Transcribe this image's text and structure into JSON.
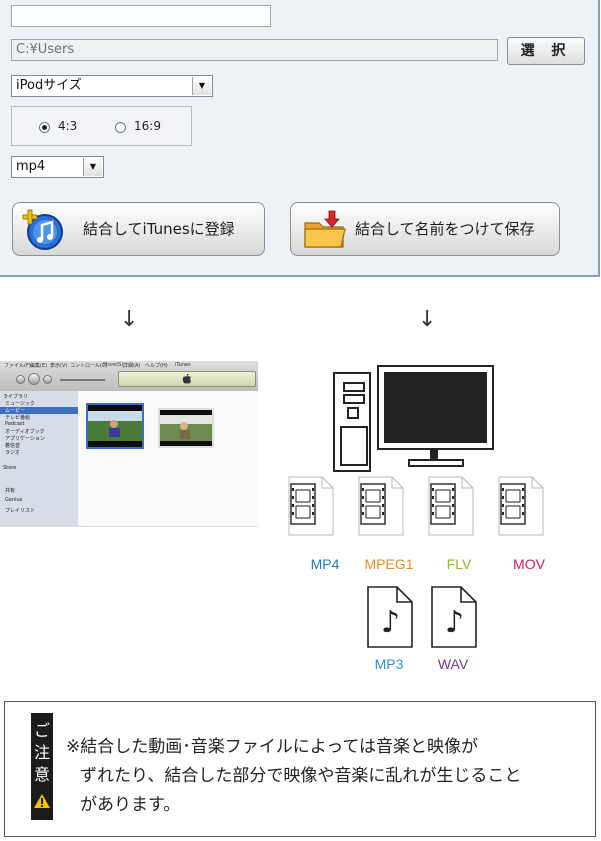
{
  "dialog": {
    "name_field_value": "",
    "path_value": "C:¥Users",
    "select_button": "選 択",
    "size_combo": "iPodサイズ",
    "aspect_options": [
      {
        "label": "4:3",
        "selected": true
      },
      {
        "label": "16:9",
        "selected": false
      }
    ],
    "format_combo": "mp4",
    "itunes_button": "結合してiTunesに登録",
    "save_button": "結合して名前をつけて保存"
  },
  "arrows": {
    "left": "↓",
    "right": "↓"
  },
  "itunes": {
    "menu": [
      "ファイル(F)",
      "編集(E)",
      "表示(V)",
      "コントロール(C)",
      "Store(S)",
      "詳細(A)",
      "ヘルプ(H)"
    ],
    "title": "iTunes",
    "sidebar": {
      "library_heading": "ライブラリ",
      "items": [
        "ミュージック",
        "ムービー",
        "テレビ番組",
        "Podcast",
        "オーディオブック",
        "アプリケーション",
        "着信音",
        "ラジオ"
      ],
      "store_heading": "Store",
      "groups": [
        "共有",
        "Genius",
        "プレイリスト"
      ]
    }
  },
  "formats": {
    "video": [
      {
        "label": "MP4",
        "color": "#1a78c8"
      },
      {
        "label": "MPEG1",
        "color": "#f08c1e"
      },
      {
        "label": "FLV",
        "color": "#8dbb2a"
      },
      {
        "label": "MOV",
        "color": "#d21b5e"
      }
    ],
    "audio": [
      {
        "label": "MP3",
        "color": "#2f8fd0"
      },
      {
        "label": "WAV",
        "color": "#6c3b9a"
      }
    ]
  },
  "notice": {
    "tag": [
      "ご",
      "注",
      "意"
    ],
    "warning_icon": "warning-icon",
    "lines": [
      "※結合した動画･音楽ファイルによっては音楽と映像が",
      "ずれたり、結合した部分で映像や音楽に乱れが生じること",
      "があります。"
    ]
  }
}
